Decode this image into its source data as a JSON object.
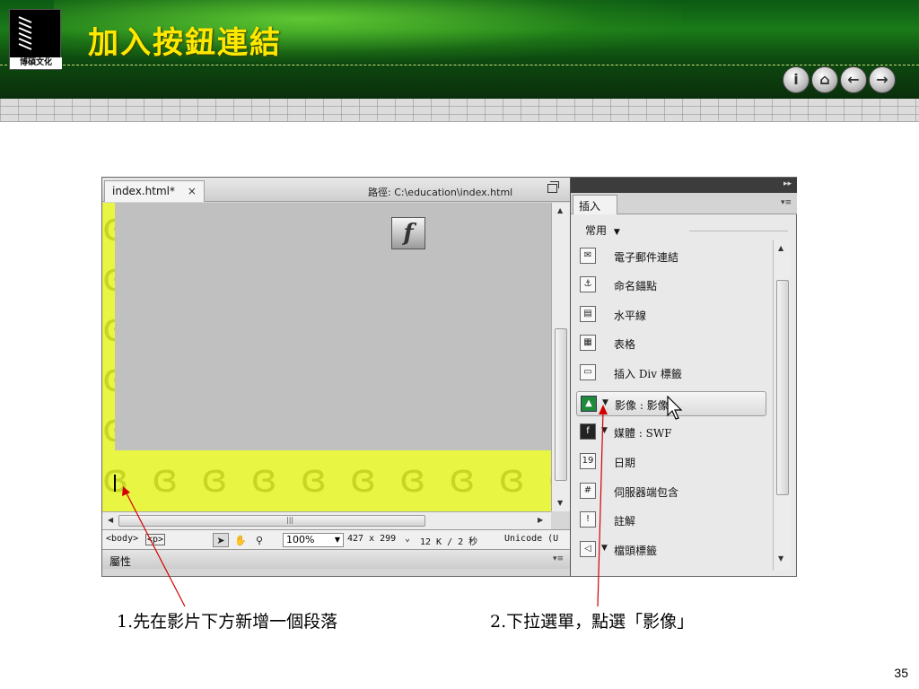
{
  "slide": {
    "title": "加入按鈕連結",
    "logo_text": "博碩文化",
    "page_number": "35",
    "nav_buttons": [
      {
        "icon": "info-icon",
        "glyph": "i"
      },
      {
        "icon": "home-icon",
        "glyph": "⌂"
      },
      {
        "icon": "back-arrow-icon",
        "glyph": "←"
      },
      {
        "icon": "forward-arrow-icon",
        "glyph": "→"
      }
    ]
  },
  "document": {
    "tab_label": "index.html*",
    "tab_close": "×",
    "path_label": "路徑:  C:\\education\\index.html",
    "flash_glyph": "f",
    "leaf_pattern": "ɞ ɞ ɞ ɞ ɞ ɞ ɞ ɞ ɞ ɞ ɞ"
  },
  "statusbar": {
    "tag_body": "<body>",
    "tag_p": "<p>",
    "zoom": "100%",
    "dimensions": "427 x 299",
    "size_time": "12 K / 2 秒",
    "encoding": "Unicode (U"
  },
  "properties_panel": {
    "label": "屬性"
  },
  "insert_panel": {
    "tab_label": "插入",
    "category": "常用",
    "items": [
      {
        "label": "電子郵件連結",
        "icon": "email-link-icon",
        "glyph": "✉",
        "has_arrow": false
      },
      {
        "label": "命名錨點",
        "icon": "anchor-icon",
        "glyph": "⚓",
        "has_arrow": false
      },
      {
        "label": "水平線",
        "icon": "horizontal-rule-icon",
        "glyph": "▤",
        "has_arrow": false
      },
      {
        "label": "表格",
        "icon": "table-icon",
        "glyph": "▦",
        "has_arrow": false
      },
      {
        "label": "插入 Div 標籤",
        "icon": "div-tag-icon",
        "glyph": "▭",
        "has_arrow": false
      },
      {
        "label": "影像 : 影像",
        "icon": "image-icon",
        "glyph": "▲",
        "has_arrow": true
      },
      {
        "label": "媒體 : SWF",
        "icon": "media-swf-icon",
        "glyph": "f",
        "has_arrow": true
      },
      {
        "label": "日期",
        "icon": "date-icon",
        "glyph": "19",
        "has_arrow": false
      },
      {
        "label": "伺服器端包含",
        "icon": "server-include-icon",
        "glyph": "#",
        "has_arrow": false
      },
      {
        "label": "註解",
        "icon": "comment-icon",
        "glyph": "!",
        "has_arrow": false
      },
      {
        "label": "檔頭標籤",
        "icon": "head-tag-icon",
        "glyph": "◁",
        "has_arrow": true
      }
    ]
  },
  "annotations": {
    "step1": "1.先在影片下方新增一個段落",
    "step2": "2.下拉選單，點選「影像」"
  },
  "colors": {
    "header_green": "#1a7a18",
    "title_yellow": "#ffe800",
    "canvas_yellow": "#e8f542",
    "annotation_red": "#d40000"
  }
}
